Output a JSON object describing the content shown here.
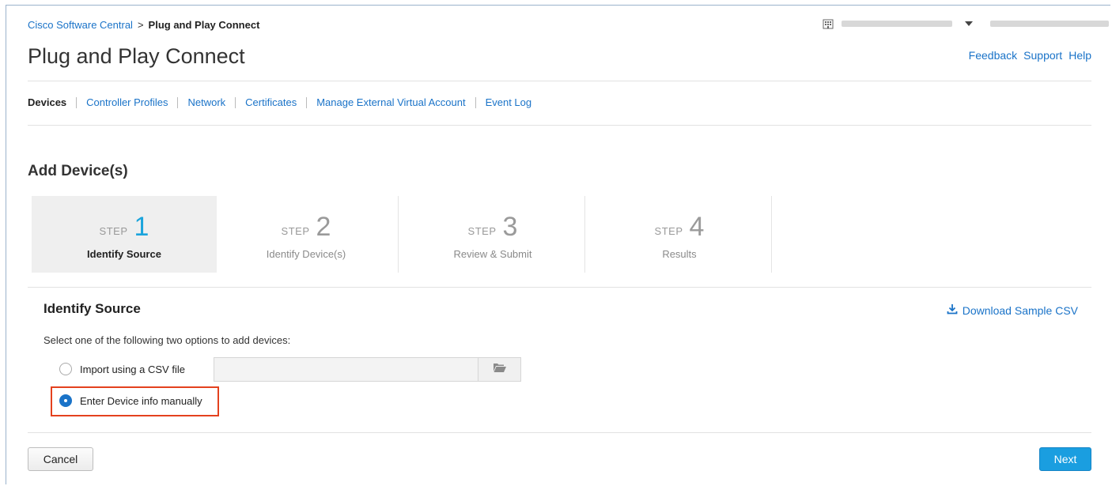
{
  "breadcrumb": {
    "parent": "Cisco Software Central",
    "separator": ">",
    "current": "Plug and Play Connect"
  },
  "header": {
    "title": "Plug and Play Connect",
    "links": {
      "feedback": "Feedback",
      "support": "Support",
      "help": "Help"
    },
    "account_icon": "building-icon"
  },
  "nav": {
    "items": [
      {
        "label": "Devices",
        "active": true
      },
      {
        "label": "Controller Profiles"
      },
      {
        "label": "Network"
      },
      {
        "label": "Certificates"
      },
      {
        "label": "Manage External Virtual Account"
      },
      {
        "label": "Event Log"
      }
    ]
  },
  "wizard": {
    "title": "Add Device(s)",
    "step_word": "STEP",
    "steps": [
      {
        "number": "1",
        "label": "Identify Source"
      },
      {
        "number": "2",
        "label": "Identify Device(s)"
      },
      {
        "number": "3",
        "label": "Review & Submit"
      },
      {
        "number": "4",
        "label": "Results"
      }
    ]
  },
  "identify": {
    "heading": "Identify Source",
    "download_label": "Download Sample CSV",
    "instruction": "Select one of the following two options to add devices:",
    "option_csv": "Import using a CSV file",
    "option_manual": "Enter Device info manually",
    "selected": "manual"
  },
  "footer": {
    "cancel_label": "Cancel",
    "next_label": "Next"
  },
  "colors": {
    "link": "#1a73c8",
    "active_step_number": "#1ba4dc",
    "next_button": "#1a9ee0",
    "highlight_box": "#e4411e"
  }
}
